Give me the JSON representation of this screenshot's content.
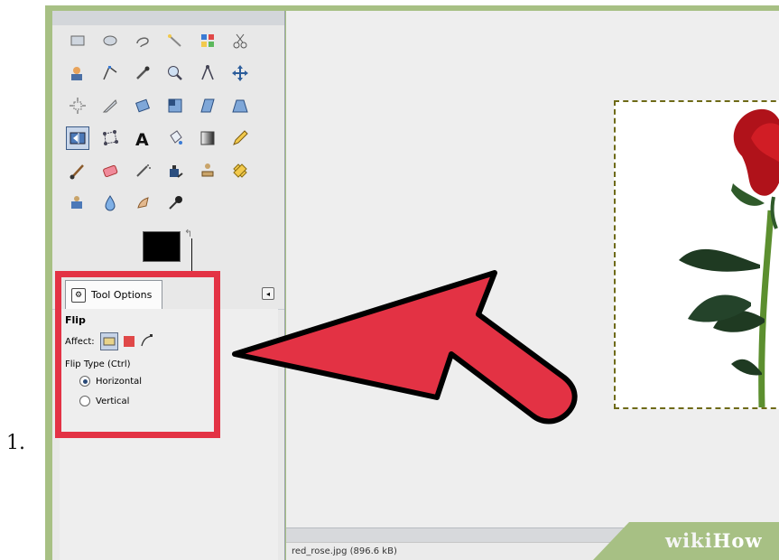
{
  "step": {
    "number": "1."
  },
  "tool_options": {
    "tab_label": "Tool Options",
    "tool_name": "Flip",
    "affect_label": "Affect:",
    "flip_type_label": "Flip Type  (Ctrl)",
    "options": [
      {
        "label": "Horizontal",
        "selected": true
      },
      {
        "label": "Vertical",
        "selected": false
      }
    ]
  },
  "status": {
    "filename": "red_rose.jpg (896.6 kB)"
  },
  "watermark": {
    "part1": "wiki",
    "part2": "How"
  },
  "colors": {
    "highlight": "#e33244",
    "arrow": "#e33244",
    "frame": "#a7c084"
  }
}
